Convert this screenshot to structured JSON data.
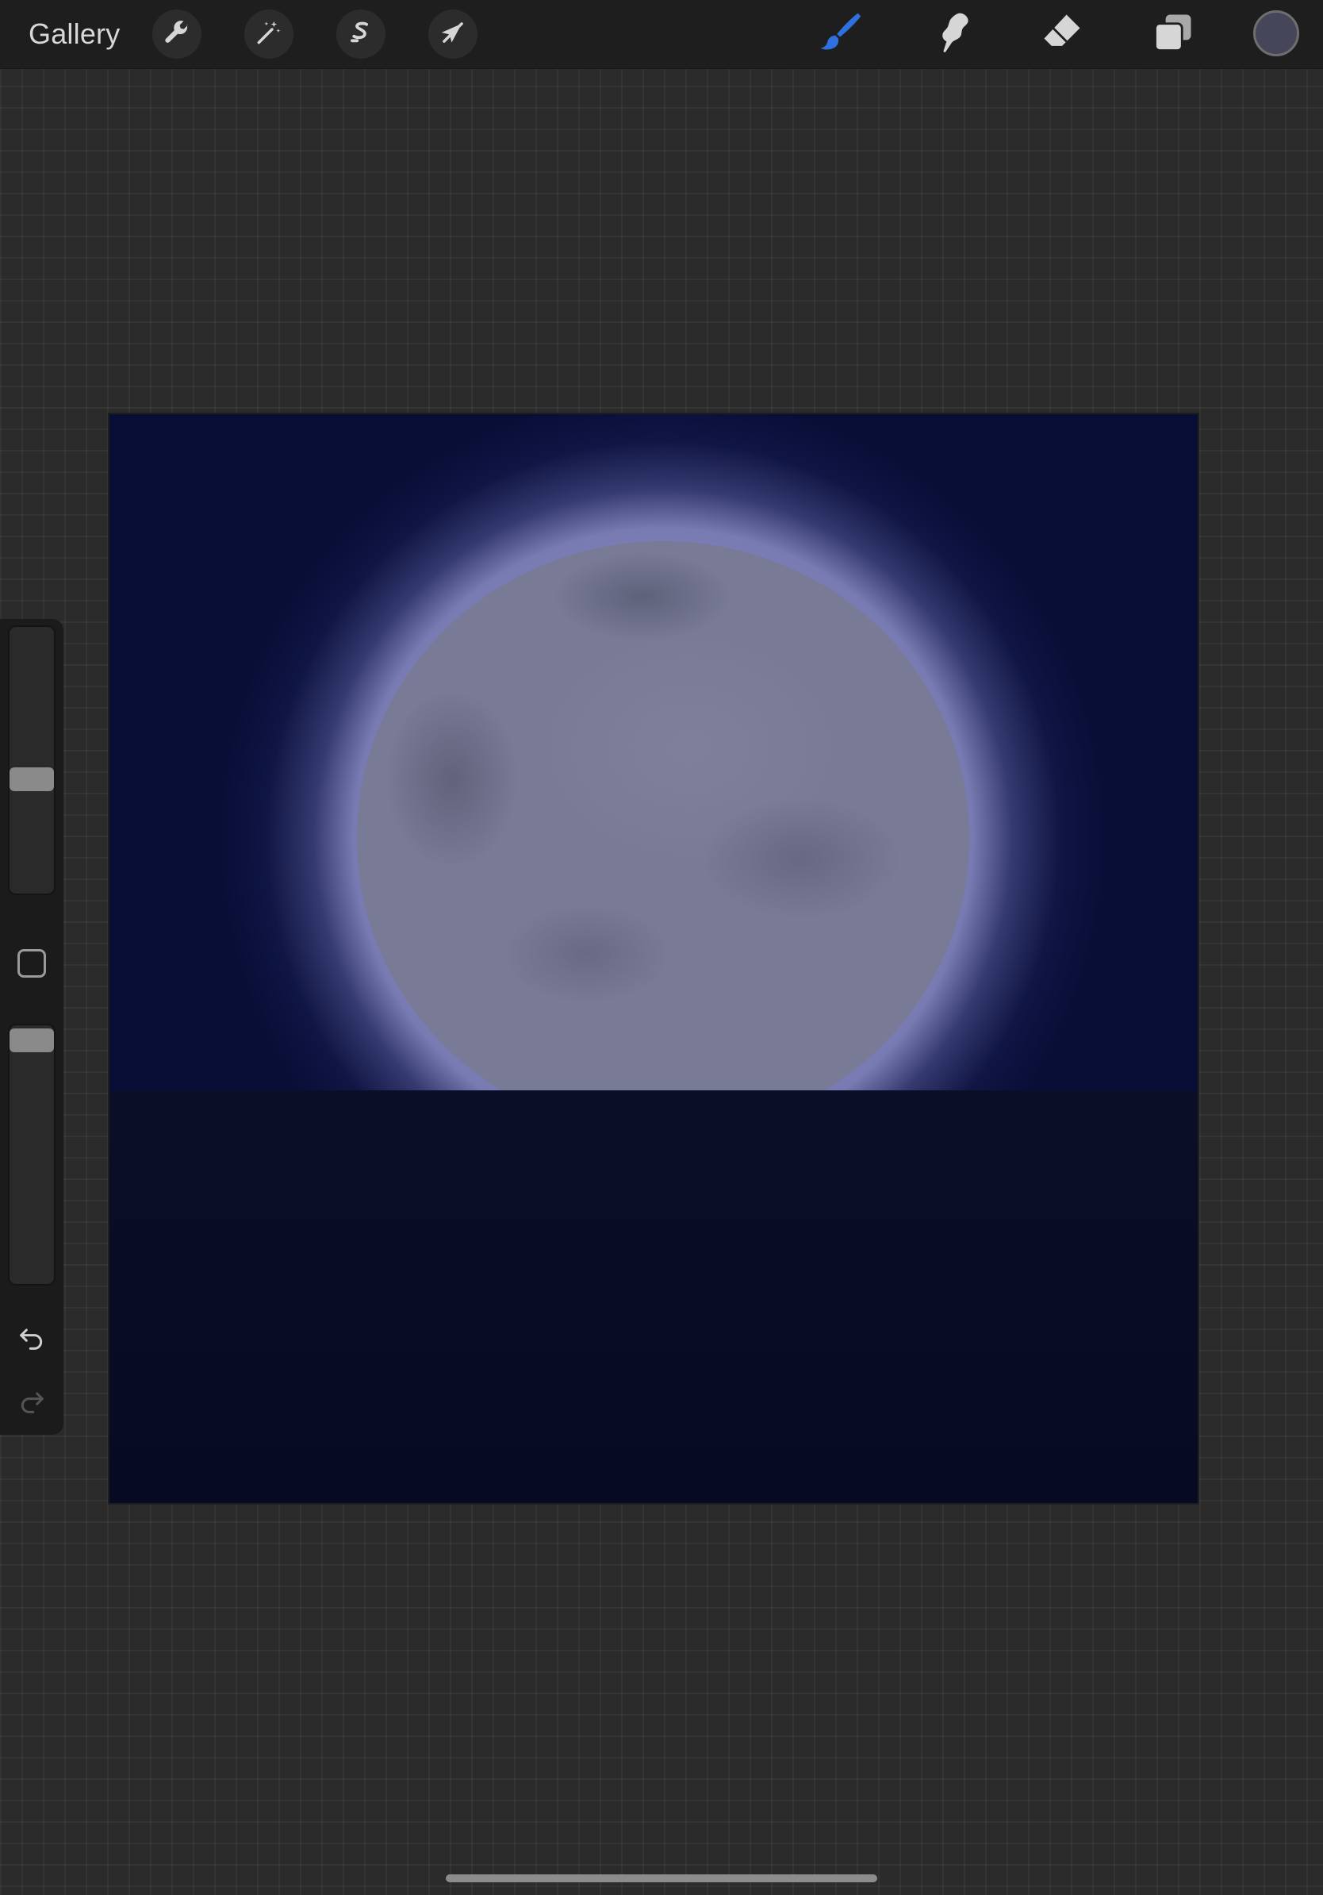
{
  "toolbar": {
    "gallery_label": "Gallery",
    "left_tools": [
      {
        "name": "actions",
        "icon": "wrench-icon"
      },
      {
        "name": "adjustments",
        "icon": "magic-wand-icon"
      },
      {
        "name": "selection",
        "icon": "selection-s-icon"
      },
      {
        "name": "transform",
        "icon": "arrow-cursor-icon"
      }
    ],
    "right_tools": [
      {
        "name": "brush",
        "icon": "brush-icon",
        "active": true,
        "color": "#2f6fe0"
      },
      {
        "name": "smudge",
        "icon": "smudge-icon",
        "active": false
      },
      {
        "name": "eraser",
        "icon": "eraser-icon",
        "active": false
      },
      {
        "name": "layers",
        "icon": "layers-icon",
        "active": false
      }
    ],
    "current_color": "#45465a"
  },
  "sidebar": {
    "brush_size_level": 0.42,
    "opacity_level": 1.0,
    "modify_button_icon": "square-icon",
    "undo_icon": "undo-arrow-icon",
    "redo_icon": "redo-arrow-icon",
    "redo_enabled": false
  },
  "canvas": {
    "sky_color": "#080e36",
    "moon_color": "#787a96",
    "water_color": "#090d26"
  }
}
